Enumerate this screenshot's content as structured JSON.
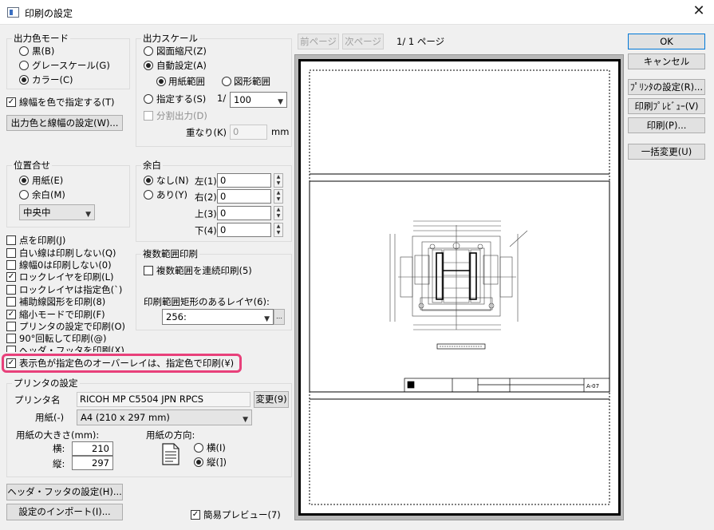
{
  "window": {
    "title": "印刷の設定",
    "close_glyph": "✕"
  },
  "output_color": {
    "label": "出力色モード",
    "options": [
      {
        "label": "黒(B)",
        "selected": false
      },
      {
        "label": "グレースケール(G)",
        "selected": false
      },
      {
        "label": "カラー(C)",
        "selected": true
      }
    ],
    "linewidth_color_label": "線幅を色で指定する(T)",
    "linewidth_color_checked": true,
    "settings_button": "出力色と線幅の設定(W)..."
  },
  "output_scale": {
    "label": "出力スケール",
    "fit_label": "図面縮尺(Z)",
    "auto_label": "自動設定(A)",
    "paper_range_label": "用紙範囲",
    "drawing_range_label": "図形範囲",
    "specify_label": "指定する(S)",
    "ratio_prefix": "1/",
    "ratio_value": "100",
    "split_label": "分割出力(D)",
    "overlap_label": "重なり(K)",
    "overlap_value": "0",
    "overlap_unit": "mm"
  },
  "position": {
    "label": "位置合せ",
    "paper_label": "用紙(E)",
    "margin_label": "余白(M)",
    "align_value": "中央中"
  },
  "margin": {
    "label": "余白",
    "none_label": "なし(N)",
    "exist_label": "あり(Y)",
    "left_label": "左(1)",
    "left_value": "0",
    "right_label": "右(2)",
    "right_value": "0",
    "top_label": "上(3)",
    "top_value": "0",
    "bottom_label": "下(4)",
    "bottom_value": "0"
  },
  "options": [
    {
      "label": "点を印刷(J)",
      "checked": false
    },
    {
      "label": "白い線は印刷しない(Q)",
      "checked": false
    },
    {
      "label": "線幅0は印刷しない(0)",
      "checked": false
    },
    {
      "label": "ロックレイヤを印刷(L)",
      "checked": true
    },
    {
      "label": "ロックレイヤは指定色(`)",
      "checked": false
    },
    {
      "label": "補助線図形を印刷(8)",
      "checked": false
    },
    {
      "label": "縮小モードで印刷(F)",
      "checked": true
    },
    {
      "label": "プリンタの設定で印刷(O)",
      "checked": false
    },
    {
      "label": "90°回転して印刷(@)",
      "checked": false
    },
    {
      "label": "ヘッダ・フッタを印刷(X)",
      "checked": false
    }
  ],
  "overlay_option": {
    "label": "表示色が指定色のオーバーレイは、指定色で印刷(¥)",
    "checked": true
  },
  "multi_range": {
    "label": "複数範囲印刷",
    "continuous_label": "複数範囲を連続印刷(5)",
    "layer_label": "印刷範囲矩形のあるレイヤ(6):",
    "layer_value": "256:"
  },
  "printer": {
    "label": "プリンタの設定",
    "name_label": "プリンタ名",
    "name_value": "RICOH MP C5504 JPN RPCS",
    "change_button": "変更(9)",
    "paper_label": "用紙(-)",
    "paper_value": "A4 (210 x 297 mm)",
    "size_label": "用紙の大きさ(mm):",
    "width_label": "横:",
    "width_value": "210",
    "height_label": "縦:",
    "height_value": "297",
    "orientation_label": "用紙の方向:",
    "landscape_label": "横(I)",
    "portrait_label": "縦(])"
  },
  "bottom": {
    "header_footer_button": "ヘッダ・フッタの設定(H)...",
    "import_button": "設定のインポート(I)...",
    "simple_preview_label": "簡易プレビュー(7)",
    "simple_preview_checked": true
  },
  "preview": {
    "prev_button": "前ページ",
    "next_button": "次ページ",
    "page_info": "1/  1 ページ",
    "title_block_value": "A-07"
  },
  "actions": {
    "ok": "OK",
    "cancel": "キャンセル",
    "printer_settings": "ﾌﾟﾘﾝﾀの設定(R)...",
    "print_preview": "印刷ﾌﾟﾚﾋﾞｭｰ(V)",
    "print": "印刷(P)...",
    "batch_change": "一括変更(U)"
  },
  "colors": {
    "highlight": "#e8407a",
    "accent": "#0078d7"
  }
}
